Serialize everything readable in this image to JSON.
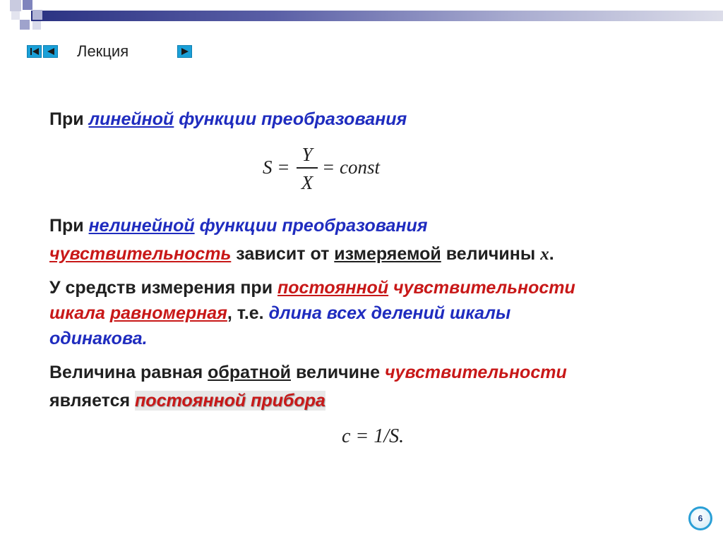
{
  "header": {
    "title": "Лекция",
    "nav": {
      "first_icon": "skip-to-start-icon",
      "prev_icon": "triangle-left-icon",
      "next_icon": "triangle-right-icon"
    }
  },
  "colors": {
    "blue_emphasis": "#1f2cbf",
    "red_emphasis": "#c81818",
    "text": "#202020",
    "nav_button": "#1aa0d8"
  },
  "content": {
    "p1": {
      "prefix": "При ",
      "linear": "линейной",
      "rest": " функции преобразования"
    },
    "formula1": {
      "lhs": "S =",
      "numerator": "Y",
      "denominator": "X",
      "rhs": "= const"
    },
    "p2": {
      "prefix": "При ",
      "nonlinear": "нелинейной",
      "rest": " функции преобразования",
      "sensitivity": "чувствительность",
      "depends": " зависит от ",
      "measured": "измеряемой",
      "quantity": " величины ",
      "x": "x",
      "dot": "."
    },
    "p3": {
      "prefix": "У средств измерения при ",
      "constant": "постоянной",
      "sensitivity": " чувствительности",
      "scale": "шкала ",
      "uniform": "равномерная",
      "ie": ", т.е. ",
      "length": "длина всех делений шкалы",
      "same": "одинакова."
    },
    "p4": {
      "prefix": "Величина равная ",
      "inverse": "обратной",
      "middle": " величине ",
      "sensitivity": "чувствительности",
      "is": "является ",
      "constant_device": "постоянной прибора"
    },
    "formula2": "c = 1/S."
  },
  "footer": {
    "page_number": "6"
  }
}
